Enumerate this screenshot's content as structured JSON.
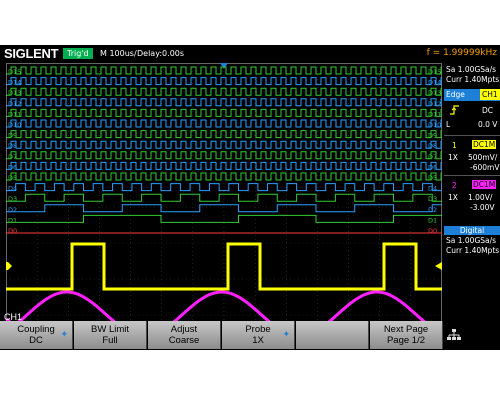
{
  "header": {
    "brand": "SIGLENT",
    "trigger_state": "Trig'd",
    "timebase": "M 100us/",
    "delay": "Delay:0.00s",
    "frequency": "f = 1.99999kHz"
  },
  "right_panel": {
    "sample_rate": "Sa 1.00GSa/s",
    "memory": "Curr 1.40Mpts",
    "trigger_type": "Edge",
    "trigger_source": "CH1",
    "slope_icon": "rising-edge-icon",
    "coupling": "DC",
    "level_label": "L",
    "level_value": "0.0 V",
    "ch1": {
      "num": "1",
      "coupling": "DC1M",
      "probe": "1X",
      "scale": "500mV/",
      "offset": "-600mV"
    },
    "ch2": {
      "num": "2",
      "coupling": "DC1M",
      "probe": "1X",
      "scale": "1.00V/",
      "offset": "-3.00V"
    },
    "digital": {
      "title": "Digital",
      "sample_rate": "Sa 1.00GSa/s",
      "memory": "Curr 1.40Mpts"
    }
  },
  "digital_channels": [
    "D15",
    "D14",
    "D13",
    "D12",
    "D11",
    "D10",
    "D9",
    "D8",
    "D7",
    "D6",
    "D5",
    "D4",
    "D3",
    "D2",
    "D1",
    "D0"
  ],
  "markers": {
    "ch1": "1",
    "ch2": "2"
  },
  "channel_label": "CH1",
  "softkeys": [
    {
      "title": "Coupling",
      "value": "DC",
      "arrow": true
    },
    {
      "title": "BW Limit",
      "value": "Full",
      "arrow": false
    },
    {
      "title": "Adjust",
      "value": "Coarse",
      "arrow": false
    },
    {
      "title": "Probe",
      "value": "1X",
      "arrow": true
    },
    {
      "title": "",
      "value": "",
      "arrow": false
    },
    {
      "title": "Next Page",
      "value": "Page 1/2",
      "arrow": false
    }
  ],
  "colors": {
    "ch1": "#ffff00",
    "ch2": "#ff20ff",
    "digital_blue": "#2aa0ff",
    "digital_green": "#33cc33",
    "d0_red": "#ff3b3b",
    "trigger_green": "#00b050",
    "freq_orange": "#f0a000",
    "digital_header_blue": "#1e7fd6"
  }
}
